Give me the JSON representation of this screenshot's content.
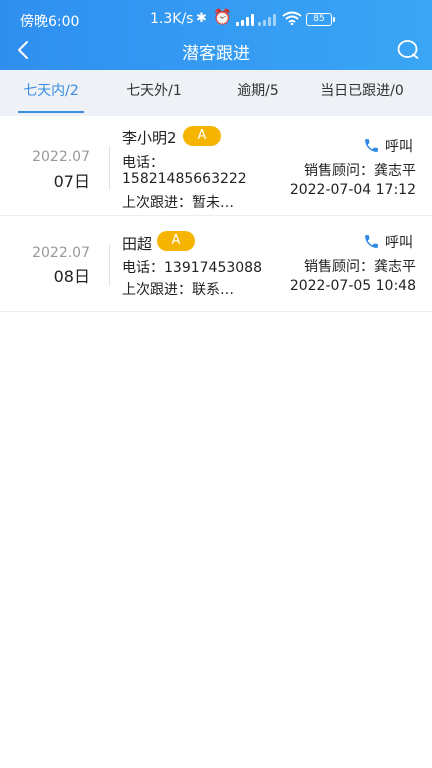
{
  "status_bar": {
    "time": "傍晚6:00",
    "network_speed": "1.3K/s",
    "battery": "85"
  },
  "nav": {
    "title": "潜客跟进",
    "back_icon": "chevron-left-icon",
    "search_icon": "search-icon"
  },
  "tabs": [
    {
      "label": "七天内/2",
      "active": true
    },
    {
      "label": "七天外/1",
      "active": false
    },
    {
      "label": "逾期/5",
      "active": false
    },
    {
      "label": "当日已跟进/0",
      "active": false
    }
  ],
  "records": [
    {
      "year_month": "2022.07",
      "day": "07日",
      "name": "李小明2",
      "level": "A",
      "phone_label": "电话：",
      "phone": "15821485663222",
      "last_follow": "上次跟进：暂未…",
      "call_label": "呼叫",
      "consultant": "销售顾问：龚志平",
      "datetime": "2022-07-04 17:12"
    },
    {
      "year_month": "2022.07",
      "day": "08日",
      "name": "田超",
      "level": "A",
      "phone_text": "电话：13917453088",
      "last_follow": "上次跟进：联系…",
      "call_label": "呼叫",
      "consultant": "销售顾问：龚志平",
      "datetime": "2022-07-05 10:48"
    }
  ],
  "colors": {
    "header_start": "#2f8ff0",
    "header_end": "#3aa6f5",
    "tab_active": "#3a8ee6",
    "badge": "#f4b400",
    "phone_icon": "#2b86e8"
  }
}
